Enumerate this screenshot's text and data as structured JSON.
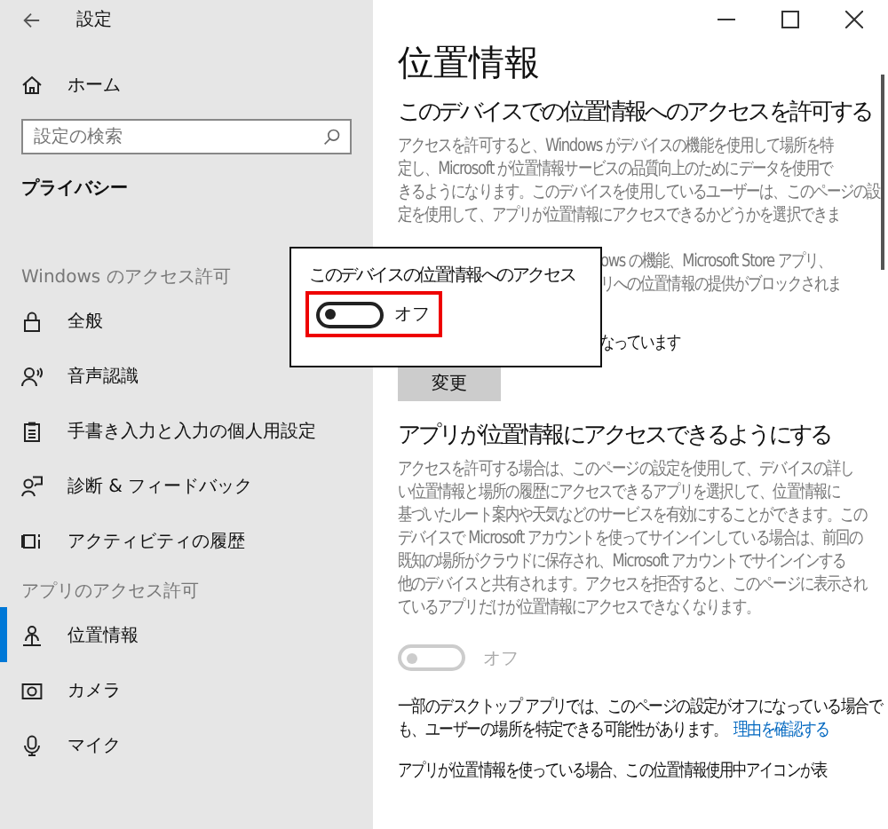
{
  "window": {
    "title": "設定"
  },
  "sidebar": {
    "home": "ホーム",
    "search": {
      "placeholder": "設定の検索"
    },
    "section": "プライバシー",
    "groups": [
      {
        "heading": "Windows のアクセス許可",
        "items": [
          {
            "label": "全般",
            "selected": false
          },
          {
            "label": "音声認識",
            "selected": false
          },
          {
            "label": "手書き入力と入力の個人用設定",
            "selected": false
          },
          {
            "label": "診断 & フィードバック",
            "selected": false
          },
          {
            "label": "アクティビティの履歴",
            "selected": false
          }
        ]
      },
      {
        "heading": "アプリのアクセス許可",
        "items": [
          {
            "label": "位置情報",
            "selected": true
          },
          {
            "label": "カメラ",
            "selected": false
          },
          {
            "label": "マイク",
            "selected": false
          }
        ]
      }
    ]
  },
  "main": {
    "title": "位置情報",
    "device_section": {
      "heading": "このデバイスでの位置情報へのアクセスを許可する",
      "description_lines": [
        "アクセスを許可すると、Windows がデバイスの機能を使用して場所を特",
        "定し、Microsoft が位置情報サービスの品質向上のためにデータを使用で",
        "きるようになります。このデバイスを使用しているユーザーは、このページの設",
        "定を使用して、アプリが位置情報にアクセスできるかどうかを選択できま"
      ],
      "fragments": [
        {
          "text": "ows の機能、Microsoft Store アプリ、",
          "kind": "description"
        },
        {
          "text": "リへの位置情報の提供がブロックされま",
          "kind": "description"
        },
        {
          "text": "なっています",
          "kind": "status"
        }
      ],
      "button": "変更"
    },
    "apps_section": {
      "heading": "アプリが位置情報にアクセスできるようにする",
      "description_lines": [
        "アクセスを許可する場合は、このページの設定を使用して、デバイスの詳し",
        "い位置情報と場所の履歴にアクセスできるアプリを選択して、位置情報に",
        "基づいたルート案内や天気などのサービスを有効にすることができます。この",
        "デバイスで Microsoft アカウントを使ってサインインしている場合は、前回の",
        "既知の場所がクラウドに保存され、Microsoft アカウントでサインインする",
        "他のデバイスと共有されます。アクセスを拒否すると、このページに表示され",
        "ているアプリだけが位置情報にアクセスできなくなります。"
      ],
      "toggle": {
        "on": false,
        "disabled": true,
        "label": "オフ"
      },
      "note_lines": [
        "一部のデスクトップ アプリでは、このページの設定がオフになっている場合で",
        "も、ユーザーの場所を特定できる可能性があります。"
      ],
      "link": "理由を確認する",
      "last_line": "アプリが位置情報を使っている場合、この位置情報使用中アイコンが表"
    }
  },
  "popup": {
    "label": "このデバイスの位置情報へのアクセス",
    "toggle": {
      "on": false,
      "disabled": false,
      "label": "オフ"
    },
    "highlighted": true
  }
}
